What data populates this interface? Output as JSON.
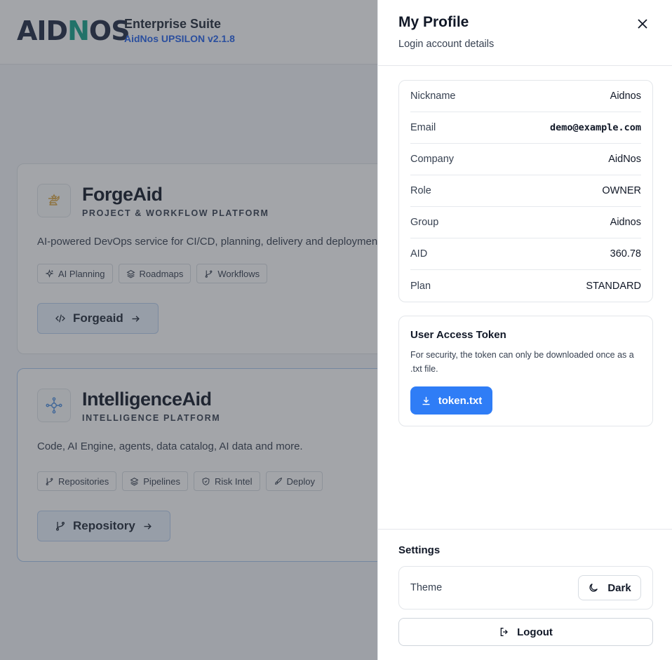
{
  "header": {
    "logo_prefix": "AID",
    "logo_accent": "N",
    "logo_suffix": "OS",
    "title": "Enterprise Suite",
    "version": "AidNos UPSILON v2.1.8"
  },
  "products": [
    {
      "title": "ForgeAid",
      "subtitle": "PROJECT & WORKFLOW PLATFORM",
      "description": "AI-powered DevOps service for CI/CD, planning, delivery and deployment.",
      "chips": [
        "AI Planning",
        "Roadmaps",
        "Workflows"
      ],
      "button": "Forgeaid"
    },
    {
      "title": "IntelligenceAid",
      "subtitle": "INTELLIGENCE PLATFORM",
      "description": "Code, AI Engine, agents, data catalog, AI data and more.",
      "chips": [
        "Repositories",
        "Pipelines",
        "Risk Intel",
        "Deploy"
      ],
      "button": "Repository"
    }
  ],
  "drawer": {
    "title": "My Profile",
    "subtitle": "Login account details",
    "profile": [
      {
        "label": "Nickname",
        "value": "Aidnos"
      },
      {
        "label": "Email",
        "value": "demo@example.com"
      },
      {
        "label": "Company",
        "value": "AidNos"
      },
      {
        "label": "Role",
        "value": "OWNER"
      },
      {
        "label": "Group",
        "value": "Aidnos"
      },
      {
        "label": "AID",
        "value": "360.78"
      },
      {
        "label": "Plan",
        "value": "STANDARD"
      }
    ],
    "token": {
      "title": "User Access Token",
      "description": "For security, the token can only be downloaded once as a .txt file.",
      "button": "token.txt"
    },
    "settings": {
      "title": "Settings",
      "theme_label": "Theme",
      "theme_value": "Dark"
    },
    "logout": "Logout"
  },
  "colors": {
    "accent": "#2f7df6",
    "logo_accent": "#14a38b",
    "version": "#2563eb"
  }
}
